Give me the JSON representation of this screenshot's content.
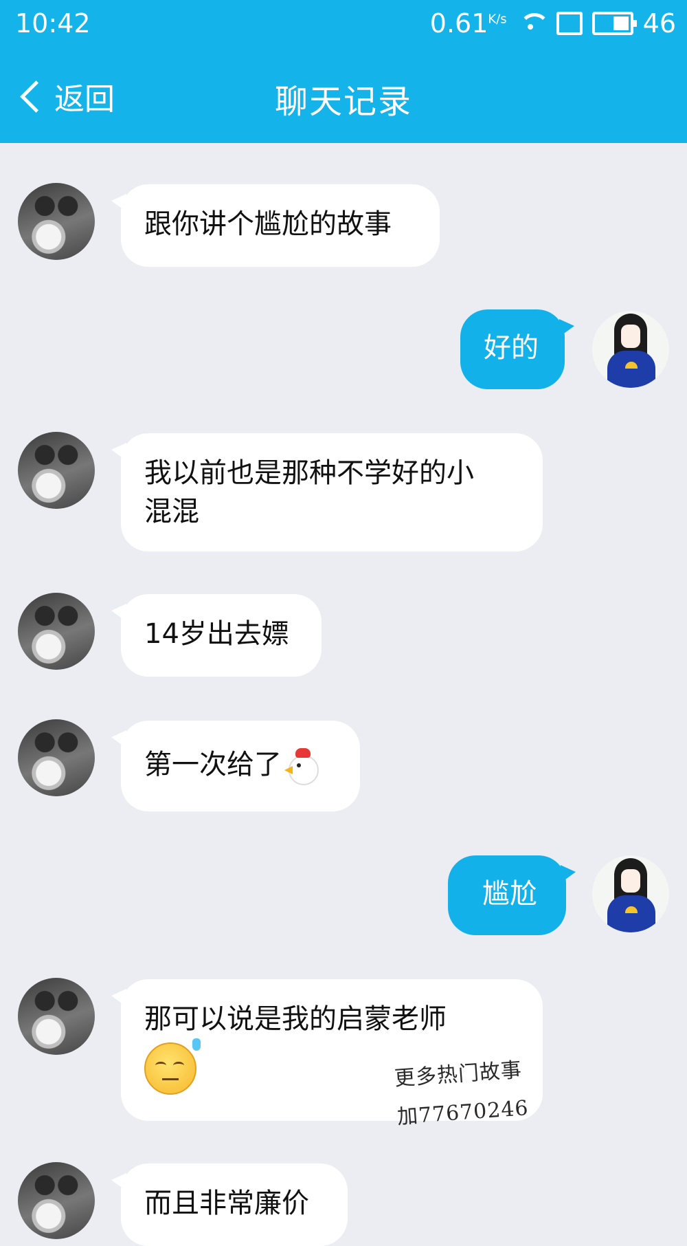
{
  "status_bar": {
    "time": "10:42",
    "speed": "0.61",
    "speed_unit": "K/s",
    "signal": "46"
  },
  "header": {
    "back_label": "返回",
    "title": "聊天记录"
  },
  "messages": [
    {
      "side": "in",
      "text": "跟你讲个尴尬的故事"
    },
    {
      "side": "out",
      "text": "好的"
    },
    {
      "side": "in",
      "text": "我以前也是那种不学好的小\n混混"
    },
    {
      "side": "in",
      "text": "14岁出去嫖"
    },
    {
      "side": "in",
      "text": "第一次给了",
      "emoji": "chicken"
    },
    {
      "side": "out",
      "text": "尴尬"
    },
    {
      "side": "in",
      "text": "那可以说是我的启蒙老师",
      "emoji": "sweat-face",
      "watermark": "更多热门故事加77670246"
    },
    {
      "side": "in",
      "text": "而且非常廉价"
    }
  ],
  "colors": {
    "header_bg": "#14b4ea",
    "outgoing_bubble": "#12b1ea",
    "incoming_bubble": "#ffffff",
    "background": "#ebedf2"
  }
}
